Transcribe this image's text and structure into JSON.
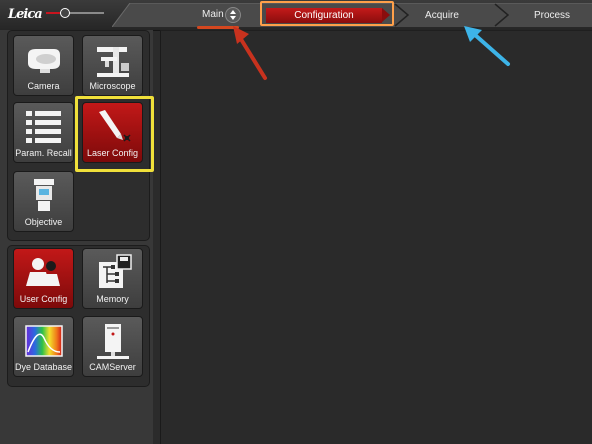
{
  "logo": {
    "text": "Leica"
  },
  "topnav": {
    "main_label": "Main",
    "tabs": [
      {
        "label": "Configuration",
        "active": true
      },
      {
        "label": "Acquire"
      },
      {
        "label": "Process"
      }
    ]
  },
  "sidebar": {
    "config_tools": [
      {
        "label": "Camera",
        "icon": "camera-icon"
      },
      {
        "label": "Microscope",
        "icon": "microscope-icon"
      },
      {
        "label": "Param. Recall",
        "icon": "list-icon"
      },
      {
        "label": "Laser Config",
        "icon": "pen-laser-icon",
        "active": true
      },
      {
        "label": "Objective",
        "icon": "objective-icon"
      }
    ],
    "user_tools": [
      {
        "label": "User Config",
        "icon": "users-icon",
        "active": true
      },
      {
        "label": "Memory",
        "icon": "memory-icon"
      },
      {
        "label": "Dye Database",
        "icon": "spectrum-icon"
      },
      {
        "label": "CAMServer",
        "icon": "server-icon"
      }
    ]
  },
  "colors": {
    "accent_red": "#c21818",
    "highlight_orange": "#ffa04a",
    "highlight_yellow": "#f0e03a",
    "arrow_red": "#c8321e",
    "arrow_blue": "#3db4e8"
  }
}
